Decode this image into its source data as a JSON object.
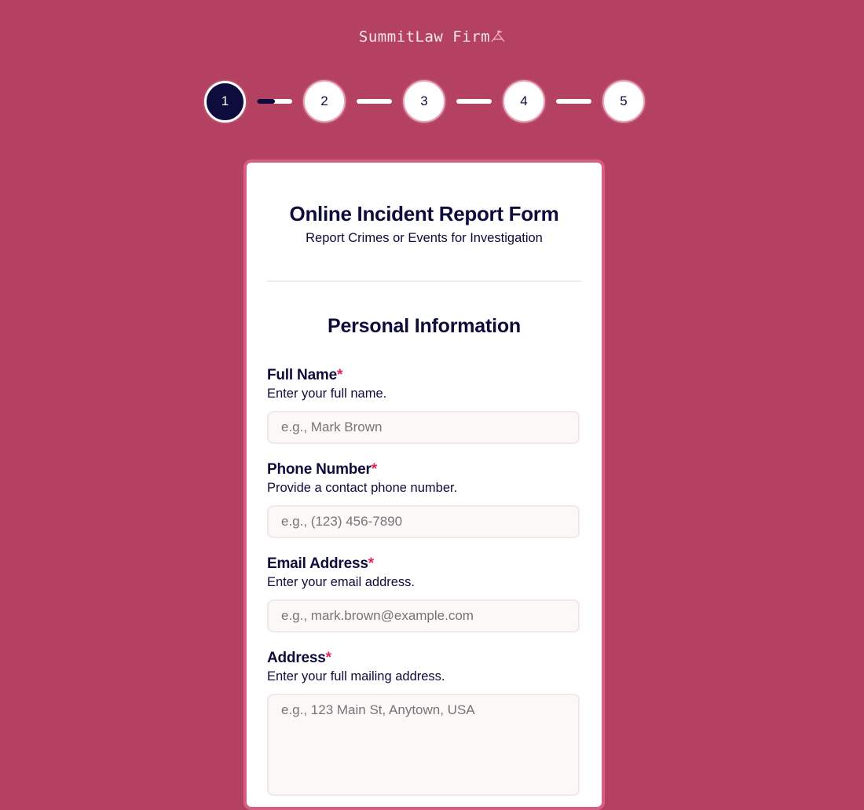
{
  "brand": {
    "name": "SummitLaw Firm",
    "icon": "summit-peak-flag-icon"
  },
  "stepper": {
    "steps": [
      "1",
      "2",
      "3",
      "4",
      "5"
    ],
    "current_step": 1,
    "first_connector_progress": 0.5
  },
  "form": {
    "title": "Online Incident Report Form",
    "subtitle": "Report Crimes or Events for Investigation",
    "section_title": "Personal Information",
    "required_marker": "*",
    "fields": [
      {
        "label": "Full Name",
        "help": "Enter your full name.",
        "placeholder": "e.g., Mark Brown",
        "value": ""
      },
      {
        "label": "Phone Number",
        "help": "Provide a contact phone number.",
        "placeholder": "e.g., (123) 456-7890",
        "value": ""
      },
      {
        "label": "Email Address",
        "help": "Enter your email address.",
        "placeholder": "e.g., mark.brown@example.com",
        "value": ""
      },
      {
        "label": "Address",
        "help": "Enter your full mailing address.",
        "placeholder": "e.g., 123 Main St, Anytown, USA",
        "value": ""
      }
    ]
  },
  "colors": {
    "background": "#B44062",
    "card_border": "#D85F84",
    "navy": "#0E0B3D",
    "required": "#E0245E"
  }
}
